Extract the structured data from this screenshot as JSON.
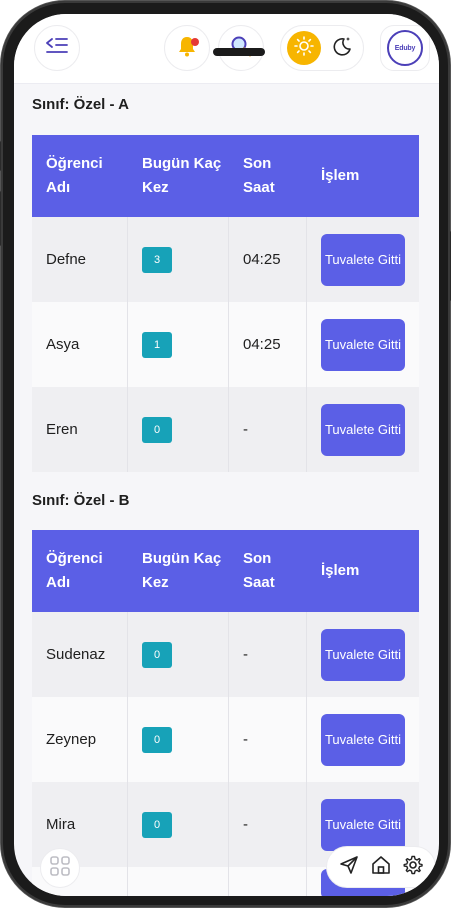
{
  "header": {
    "menu_icon": "menu-collapse-icon",
    "notification_icon": "bell-icon",
    "search_icon": "search-icon",
    "light_icon": "sun-icon",
    "dark_icon": "moon-icon",
    "logo_text": "Eduby",
    "accent": "#5b5fe6",
    "sun_color": "#f7b500"
  },
  "sections": [
    {
      "title": "Sınıf: Özel - A",
      "columns": [
        "Öğrenci Adı",
        "Bugün Kaç Kez",
        "Son Saat",
        "İşlem"
      ],
      "rows": [
        {
          "name": "Defne",
          "count": "3",
          "last": "04:25",
          "action": "Tuvalete Gitti"
        },
        {
          "name": "Asya",
          "count": "1",
          "last": "04:25",
          "action": "Tuvalete Gitti"
        },
        {
          "name": "Eren",
          "count": "0",
          "last": "-",
          "action": "Tuvalete Gitti"
        }
      ]
    },
    {
      "title": "Sınıf: Özel - B",
      "columns": [
        "Öğrenci Adı",
        "Bugün Kaç Kez",
        "Son Saat",
        "İşlem"
      ],
      "rows": [
        {
          "name": "Sudenaz",
          "count": "0",
          "last": "-",
          "action": "Tuvalete Gitti"
        },
        {
          "name": "Zeynep",
          "count": "0",
          "last": "-",
          "action": "Tuvalete Gitti"
        },
        {
          "name": "Mira",
          "count": "0",
          "last": "-",
          "action": "Tuvalete Gitti"
        }
      ]
    }
  ],
  "bottom": {
    "apps_icon": "grid-icon",
    "send_icon": "send-icon",
    "home_icon": "home-icon",
    "settings_icon": "gear-icon"
  }
}
